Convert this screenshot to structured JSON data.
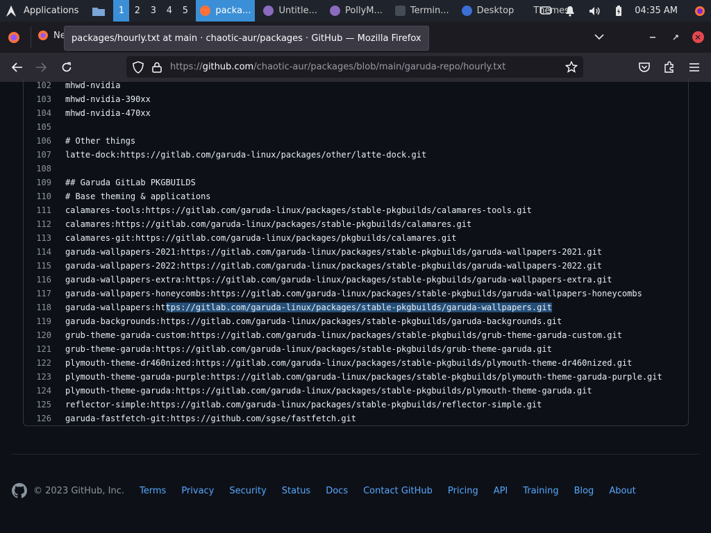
{
  "taskbar": {
    "applications_label": "Applications",
    "workspaces": [
      "1",
      "2",
      "3",
      "4",
      "5"
    ],
    "active_workspace": "1",
    "tasks": [
      {
        "label": "packa...",
        "icon": "firefox-icon",
        "active": true
      },
      {
        "label": "Untitle...",
        "icon": "app-icon",
        "active": false
      },
      {
        "label": "PollyM...",
        "icon": "app-icon",
        "active": false
      },
      {
        "label": "Termin...",
        "icon": "terminal-icon",
        "active": false
      },
      {
        "label": "Desktop",
        "icon": "desktop-icon",
        "active": false
      },
      {
        "label": "Themes",
        "icon": "",
        "active": false
      }
    ],
    "clock": "04:35 AM"
  },
  "browser": {
    "tab_partial": "Ne",
    "tooltip": "packages/hourly.txt at main · chaotic-aur/packages · GitHub — Mozilla Firefox",
    "url_prefix": "https://",
    "url_domain": "github.com",
    "url_path": "/chaotic-aur/packages/blob/main/garuda-repo/hourly.txt"
  },
  "code": {
    "lines": [
      {
        "n": "102",
        "text": "mhwd-nvidia"
      },
      {
        "n": "103",
        "text": "mhwd-nvidia-390xx"
      },
      {
        "n": "104",
        "text": "mhwd-nvidia-470xx"
      },
      {
        "n": "105",
        "text": ""
      },
      {
        "n": "106",
        "text": "# Other things"
      },
      {
        "n": "107",
        "text": "latte-dock:https://gitlab.com/garuda-linux/packages/other/latte-dock.git"
      },
      {
        "n": "108",
        "text": ""
      },
      {
        "n": "109",
        "text": "## Garuda GitLab PKGBUILDS"
      },
      {
        "n": "110",
        "text": "# Base theming & applications"
      },
      {
        "n": "111",
        "text": "calamares-tools:https://gitlab.com/garuda-linux/packages/stable-pkgbuilds/calamares-tools.git"
      },
      {
        "n": "112",
        "text": "calamares:https://gitlab.com/garuda-linux/packages/stable-pkgbuilds/calamares.git"
      },
      {
        "n": "113",
        "text": "calamares-git:https://gitlab.com/garuda-linux/packages/pkgbuilds/calamares.git"
      },
      {
        "n": "114",
        "text": "garuda-wallpapers-2021:https://gitlab.com/garuda-linux/packages/stable-pkgbuilds/garuda-wallpapers-2021.git"
      },
      {
        "n": "115",
        "text": "garuda-wallpapers-2022:https://gitlab.com/garuda-linux/packages/stable-pkgbuilds/garuda-wallpapers-2022.git"
      },
      {
        "n": "116",
        "text": "garuda-wallpapers-extra:https://gitlab.com/garuda-linux/packages/stable-pkgbuilds/garuda-wallpapers-extra.git"
      },
      {
        "n": "117",
        "text": "garuda-wallpapers-honeycombs:https://gitlab.com/garuda-linux/packages/stable-pkgbuilds/garuda-wallpapers-honeycombs"
      },
      {
        "n": "118",
        "text": "garuda-wallpapers:ht",
        "selected": "tps://gitlab.com/garuda-linux/packages/stable-pkgbuilds/garuda-wallpapers.git"
      },
      {
        "n": "119",
        "text": "garuda-backgrounds:https://gitlab.com/garuda-linux/packages/stable-pkgbuilds/garuda-backgrounds.git"
      },
      {
        "n": "120",
        "text": "grub-theme-garuda-custom:https://gitlab.com/garuda-linux/packages/stable-pkgbuilds/grub-theme-garuda-custom.git"
      },
      {
        "n": "121",
        "text": "grub-theme-garuda:https://gitlab.com/garuda-linux/packages/stable-pkgbuilds/grub-theme-garuda.git"
      },
      {
        "n": "122",
        "text": "plymouth-theme-dr460nized:https://gitlab.com/garuda-linux/packages/stable-pkgbuilds/plymouth-theme-dr460nized.git"
      },
      {
        "n": "123",
        "text": "plymouth-theme-garuda-purple:https://gitlab.com/garuda-linux/packages/stable-pkgbuilds/plymouth-theme-garuda-purple.git"
      },
      {
        "n": "124",
        "text": "plymouth-theme-garuda:https://gitlab.com/garuda-linux/packages/stable-pkgbuilds/plymouth-theme-garuda.git"
      },
      {
        "n": "125",
        "text": "reflector-simple:https://gitlab.com/garuda-linux/packages/stable-pkgbuilds/reflector-simple.git"
      },
      {
        "n": "126",
        "text": "garuda-fastfetch-git:https://github.com/sgse/fastfetch.git"
      }
    ]
  },
  "footer": {
    "copyright": "© 2023 GitHub, Inc.",
    "links": [
      "Terms",
      "Privacy",
      "Security",
      "Status",
      "Docs",
      "Contact GitHub",
      "Pricing",
      "API",
      "Training",
      "Blog",
      "About"
    ]
  },
  "colors": {
    "accent": "#3b8fd6",
    "link": "#58a6ff",
    "selection": "#264f78",
    "page_bg": "#0d1117"
  }
}
